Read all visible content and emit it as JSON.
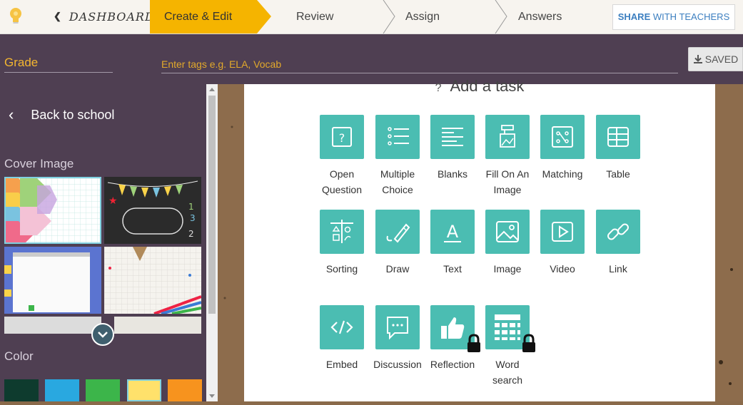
{
  "topnav": {
    "dashboard_label": "DASHBOARD",
    "steps": [
      "Create & Edit",
      "Review",
      "Assign",
      "Answers"
    ],
    "share_label_bold": "SHARE",
    "share_label_rest": " WITH TEACHERS"
  },
  "header": {
    "grade_placeholder": "Grade",
    "tags_placeholder": "Enter tags e.g. ELA, Vocab",
    "saved_label": "SAVED"
  },
  "sidebar": {
    "back_label": "Back to school",
    "cover_image_title": "Cover Image",
    "color_title": "Color",
    "swatches": [
      "#0e3b2e",
      "#29a8e0",
      "#3cb54a",
      "#ffe16b",
      "#f7931e"
    ]
  },
  "main": {
    "title": "Add a task",
    "tasks": [
      {
        "label": "Open\nQuestion",
        "icon": "open-question-icon"
      },
      {
        "label": "Multiple\nChoice",
        "icon": "multiple-choice-icon"
      },
      {
        "label": "Blanks",
        "icon": "blanks-icon"
      },
      {
        "label": "Fill On An\nImage",
        "icon": "fill-on-image-icon"
      },
      {
        "label": "Matching",
        "icon": "matching-icon"
      },
      {
        "label": "Table",
        "icon": "table-icon"
      },
      {
        "label": "Sorting",
        "icon": "sorting-icon"
      },
      {
        "label": "Draw",
        "icon": "draw-icon"
      },
      {
        "label": "Text",
        "icon": "text-icon"
      },
      {
        "label": "Image",
        "icon": "image-icon"
      },
      {
        "label": "Video",
        "icon": "video-icon"
      },
      {
        "label": "Link",
        "icon": "link-icon"
      },
      {
        "label": "Embed",
        "icon": "embed-icon"
      },
      {
        "label": "Discussion",
        "icon": "discussion-icon"
      },
      {
        "label": "Reflection",
        "icon": "reflection-icon",
        "locked": true
      },
      {
        "label": "Word\nsearch",
        "icon": "word-search-icon",
        "locked": true
      }
    ]
  },
  "colors": {
    "accent": "#f5b400",
    "tile": "#4bbdb2",
    "sidebar": "#4f3f52"
  }
}
